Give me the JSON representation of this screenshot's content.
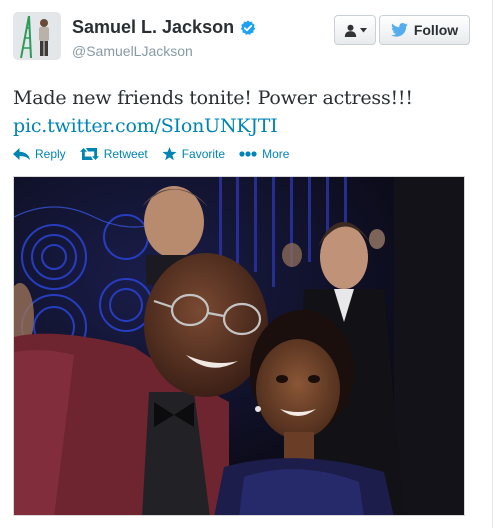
{
  "user": {
    "full_name": "Samuel L. Jackson",
    "username": "@SamuelLJackson",
    "verified": true,
    "avatar_icon": "avatar-icon"
  },
  "buttons": {
    "user_dropdown_icon": "person-icon",
    "follow_label": "Follow",
    "follow_icon": "twitter-bird-icon"
  },
  "tweet": {
    "text": "Made new friends tonite! Power actress!!!",
    "link": "pic.twitter.com/SIonUNKJTI"
  },
  "actions": [
    {
      "label": "Reply",
      "icon": "reply-icon"
    },
    {
      "label": "Retweet",
      "icon": "retweet-icon"
    },
    {
      "label": "Favorite",
      "icon": "star-icon"
    },
    {
      "label": "More",
      "icon": "dots-icon"
    }
  ],
  "colors": {
    "link": "#0084b4",
    "verified": "#1da1f2",
    "name": "#292f33",
    "meta": "#8899a6"
  }
}
